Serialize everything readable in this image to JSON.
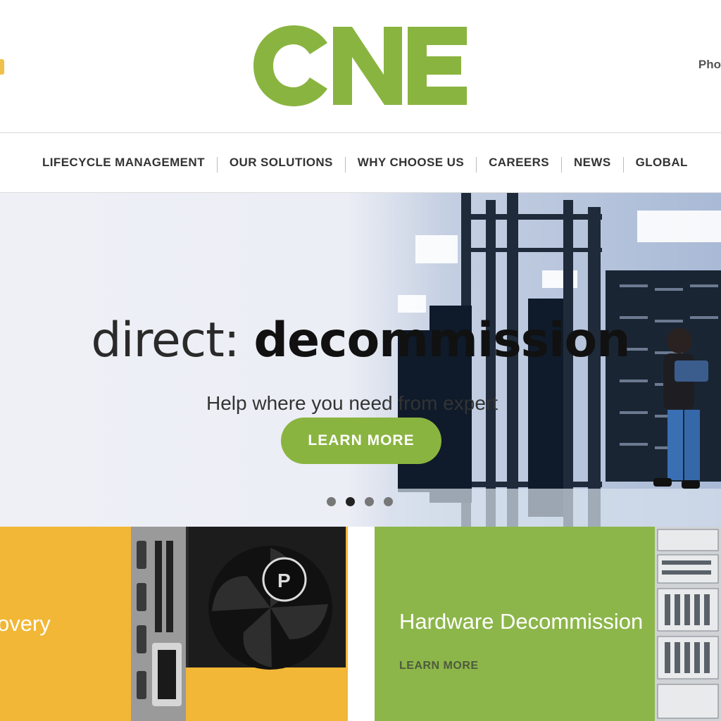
{
  "brand": {
    "logo_text": "CNE",
    "logo_color": "#8ab440"
  },
  "header": {
    "phone_fragment": "Pho"
  },
  "nav": {
    "items": [
      {
        "label": "LIFECYCLE MANAGEMENT"
      },
      {
        "label": "OUR SOLUTIONS"
      },
      {
        "label": "WHY CHOOSE US"
      },
      {
        "label": "CAREERS"
      },
      {
        "label": "NEWS"
      },
      {
        "label": "GLOBAL"
      }
    ]
  },
  "hero": {
    "title_light": "direct:",
    "title_bold": "decommission",
    "subtitle": "Help where you need from expert",
    "cta_label": "LEARN MORE",
    "slide_count": 4,
    "active_slide": 2
  },
  "cards": [
    {
      "title_fragment": "overy",
      "color": "#f2b736"
    },
    {
      "title": "Hardware Decommission",
      "link_label": "LEARN MORE",
      "color": "#8cb64a"
    }
  ],
  "icons": {
    "gpu_image": "graphics-card-photo",
    "server_image": "server-rack-photo",
    "datacenter_image": "data-center-photo"
  }
}
